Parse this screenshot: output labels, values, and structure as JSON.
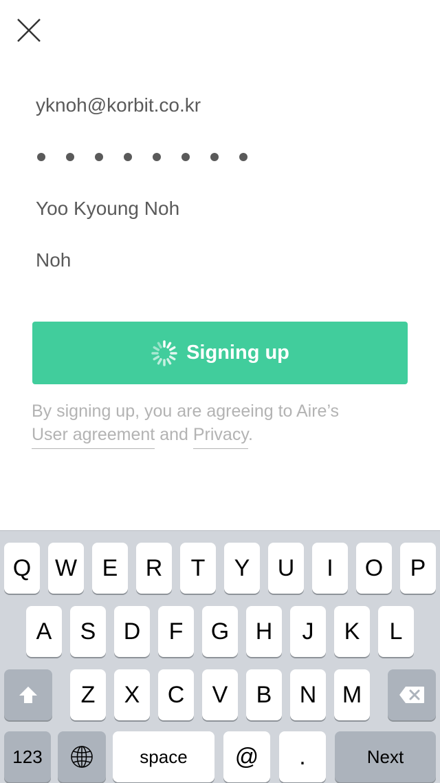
{
  "form": {
    "email": "yknoh@korbit.co.kr",
    "first_name": "Yoo Kyoung Noh",
    "last_name": "Noh"
  },
  "signup_button": {
    "label": "Signing up"
  },
  "legal": {
    "prefix": "By signing up, you are agreeing to Aire’s",
    "user_agreement": "User agreement",
    "and": "and",
    "privacy": "Privacy",
    "period": "."
  },
  "keyboard": {
    "row1": [
      "Q",
      "W",
      "E",
      "R",
      "T",
      "Y",
      "U",
      "I",
      "O",
      "P"
    ],
    "row2": [
      "A",
      "S",
      "D",
      "F",
      "G",
      "H",
      "J",
      "K",
      "L"
    ],
    "row3": [
      "Z",
      "X",
      "C",
      "V",
      "B",
      "N",
      "M"
    ],
    "numbers": "123",
    "space": "space",
    "at": "@",
    "dot": ".",
    "next": "Next"
  },
  "icons": {
    "close": "close-icon",
    "spinner": "spinner-icon",
    "shift": "shift-icon",
    "backspace": "backspace-icon",
    "globe": "globe-icon"
  },
  "colors": {
    "accent": "#41cd9c",
    "text": "#5a5a5a",
    "muted": "#b3b3b3"
  }
}
